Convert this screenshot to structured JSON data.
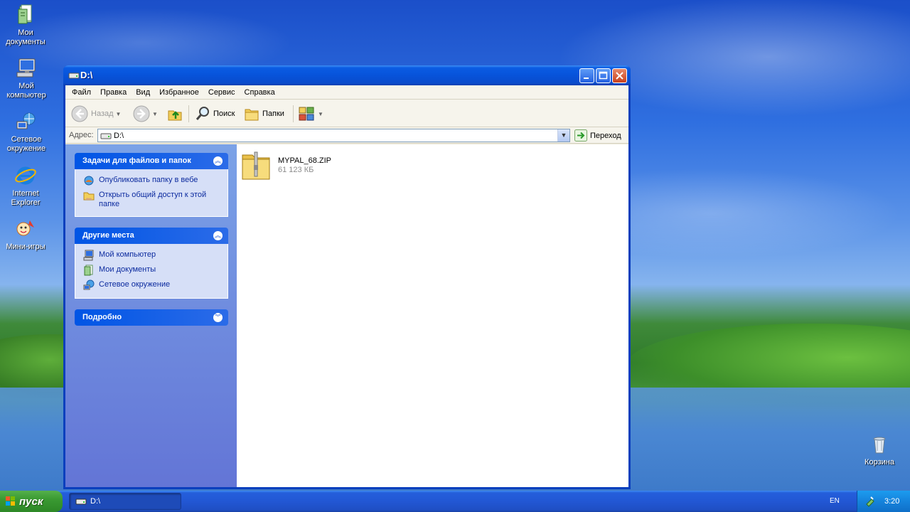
{
  "desktop": {
    "icons": [
      {
        "label": "Мои документы",
        "icon": "my-documents-icon"
      },
      {
        "label": "Мой компьютер",
        "icon": "my-computer-icon"
      },
      {
        "label": "Сетевое окружение",
        "icon": "network-places-icon"
      },
      {
        "label": "Internet Explorer",
        "icon": "internet-explorer-icon"
      },
      {
        "label": "Мини-игры",
        "icon": "mini-games-icon"
      },
      {
        "label": "Корзина",
        "icon": "recycle-bin-icon"
      }
    ]
  },
  "window": {
    "title": "D:\\",
    "menu": [
      "Файл",
      "Правка",
      "Вид",
      "Избранное",
      "Сервис",
      "Справка"
    ],
    "toolbar": {
      "back": "Назад",
      "search": "Поиск",
      "folders": "Папки"
    },
    "address": {
      "label": "Адрес:",
      "value": "D:\\",
      "go": "Переход"
    },
    "taskpane": {
      "file_tasks": {
        "title": "Задачи для файлов и папок",
        "items": [
          "Опубликовать папку в вебе",
          "Открыть общий доступ к этой папке"
        ]
      },
      "other_places": {
        "title": "Другие места",
        "items": [
          "Мой компьютер",
          "Мои документы",
          "Сетевое окружение"
        ]
      },
      "details": {
        "title": "Подробно"
      }
    },
    "files": [
      {
        "name": "MYPAL_68.ZIP",
        "size": "61 123 КБ",
        "icon": "zip-folder-icon"
      }
    ]
  },
  "taskbar": {
    "start": "пуск",
    "task": "D:\\",
    "lang": "EN",
    "clock": "3:20"
  },
  "colors": {
    "titlebar": "#0753da",
    "taskpane": "#7ba2e7",
    "start": "#3a9a32",
    "link": "#0c2b9f"
  }
}
